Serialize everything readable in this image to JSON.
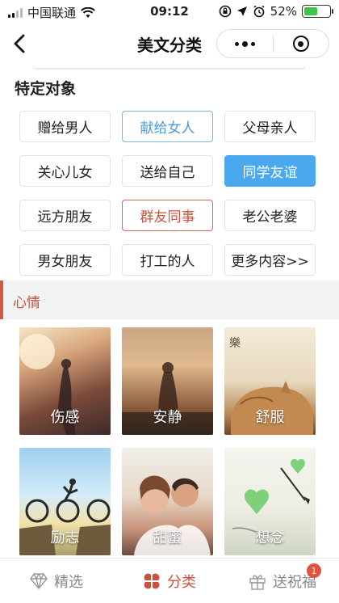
{
  "status_bar": {
    "carrier": "中国联通",
    "time": "09:12",
    "battery": "52%",
    "battery_level": 0.52
  },
  "nav": {
    "title": "美文分类"
  },
  "specific": {
    "title": "特定对象",
    "tags": [
      "赠给男人",
      "献给女人",
      "父母亲人",
      "关心儿女",
      "送给自己",
      "同学友谊",
      "远方朋友",
      "群友同事",
      "老公老婆",
      "男女朋友",
      "打工的人",
      "更多内容>>"
    ]
  },
  "mood": {
    "title": "心情",
    "cards": [
      "伤感",
      "安静",
      "舒服",
      "励志",
      "甜蜜",
      "想念"
    ]
  },
  "tabbar": {
    "tabs": [
      "精选",
      "分类",
      "送祝福"
    ],
    "badge": "1"
  },
  "colors": {
    "accent": "#c9533f",
    "blue": "#4aa8ee"
  }
}
